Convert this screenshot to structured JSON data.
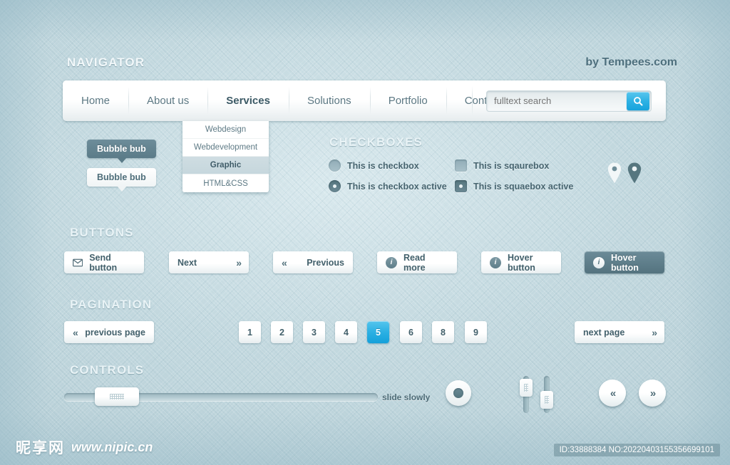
{
  "brand": {
    "title": "NAVIGATOR",
    "by": "by Tempees.com"
  },
  "nav": {
    "items": [
      {
        "label": "Home",
        "active": false
      },
      {
        "label": "About us",
        "active": false
      },
      {
        "label": "Services",
        "active": true
      },
      {
        "label": "Solutions",
        "active": false
      },
      {
        "label": "Portfolio",
        "active": false
      },
      {
        "label": "Contact",
        "active": false
      }
    ],
    "search": {
      "placeholder": "fulltext search",
      "value": "",
      "button_icon": "search-icon",
      "button_color": "#2eb2e4"
    },
    "dropdown": [
      {
        "label": "Webdesign",
        "active": false
      },
      {
        "label": "Webdevelopment",
        "active": false
      },
      {
        "label": "Graphic",
        "active": true
      },
      {
        "label": "HTML&CSS",
        "active": false
      }
    ]
  },
  "bubbles": {
    "dark_label": "Bubble bub",
    "light_label": "Bubble bub",
    "dark_color": "#5b7b88",
    "light_color": "#ffffff"
  },
  "checkboxes": {
    "heading": "CHECKBOXES",
    "items": [
      {
        "label": "This is checkbox",
        "type": "radio",
        "checked": false
      },
      {
        "label": "This is sqaurebox",
        "type": "square",
        "checked": false
      },
      {
        "label": "This is checkbox active",
        "type": "radio",
        "checked": true
      },
      {
        "label": "This is squaebox active",
        "type": "square",
        "checked": true
      }
    ]
  },
  "pins": [
    {
      "name": "map-pin-light",
      "color": "#f2f7f8"
    },
    {
      "name": "map-pin-dark",
      "color": "#56767f"
    }
  ],
  "buttons": {
    "heading": "BUTTONS",
    "items": [
      {
        "label": "Send button",
        "icon": "envelope-icon",
        "style": "light",
        "align": "left"
      },
      {
        "label": "Next",
        "icon": "chevron-double-right-icon",
        "style": "light",
        "align": "spread"
      },
      {
        "label": "Previous",
        "icon": "chevron-double-left-icon",
        "style": "light",
        "align": "spread"
      },
      {
        "label": "Read more",
        "icon": "info-icon",
        "style": "light",
        "align": "left"
      },
      {
        "label": "Hover button",
        "icon": "info-icon",
        "style": "light",
        "align": "left"
      },
      {
        "label": "Hover button",
        "icon": "info-icon",
        "style": "dark",
        "align": "left"
      }
    ]
  },
  "pagination": {
    "heading": "PAGINATION",
    "prev_label": "previous page",
    "next_label": "next page",
    "pages": [
      "1",
      "2",
      "3",
      "4",
      "5",
      "6",
      "8",
      "9"
    ],
    "active_page": "5",
    "active_color": "#2bb0e3"
  },
  "controls": {
    "heading": "CONTROLS",
    "slider_label": "slide slowly",
    "slider_value_pct": 10,
    "vertical_sliders": [
      {
        "name": "vertical-slider-left",
        "handle_pct": 18
      },
      {
        "name": "vertical-slider-right",
        "handle_pct": 62
      }
    ],
    "prev_icon": "chevron-double-left-icon",
    "next_icon": "chevron-double-right-icon"
  },
  "footer": {
    "watermark_cjk": "昵享网",
    "watermark_url": "www.nipic.cn",
    "id_text": "ID:33888384 NO:20220403155356699101"
  }
}
